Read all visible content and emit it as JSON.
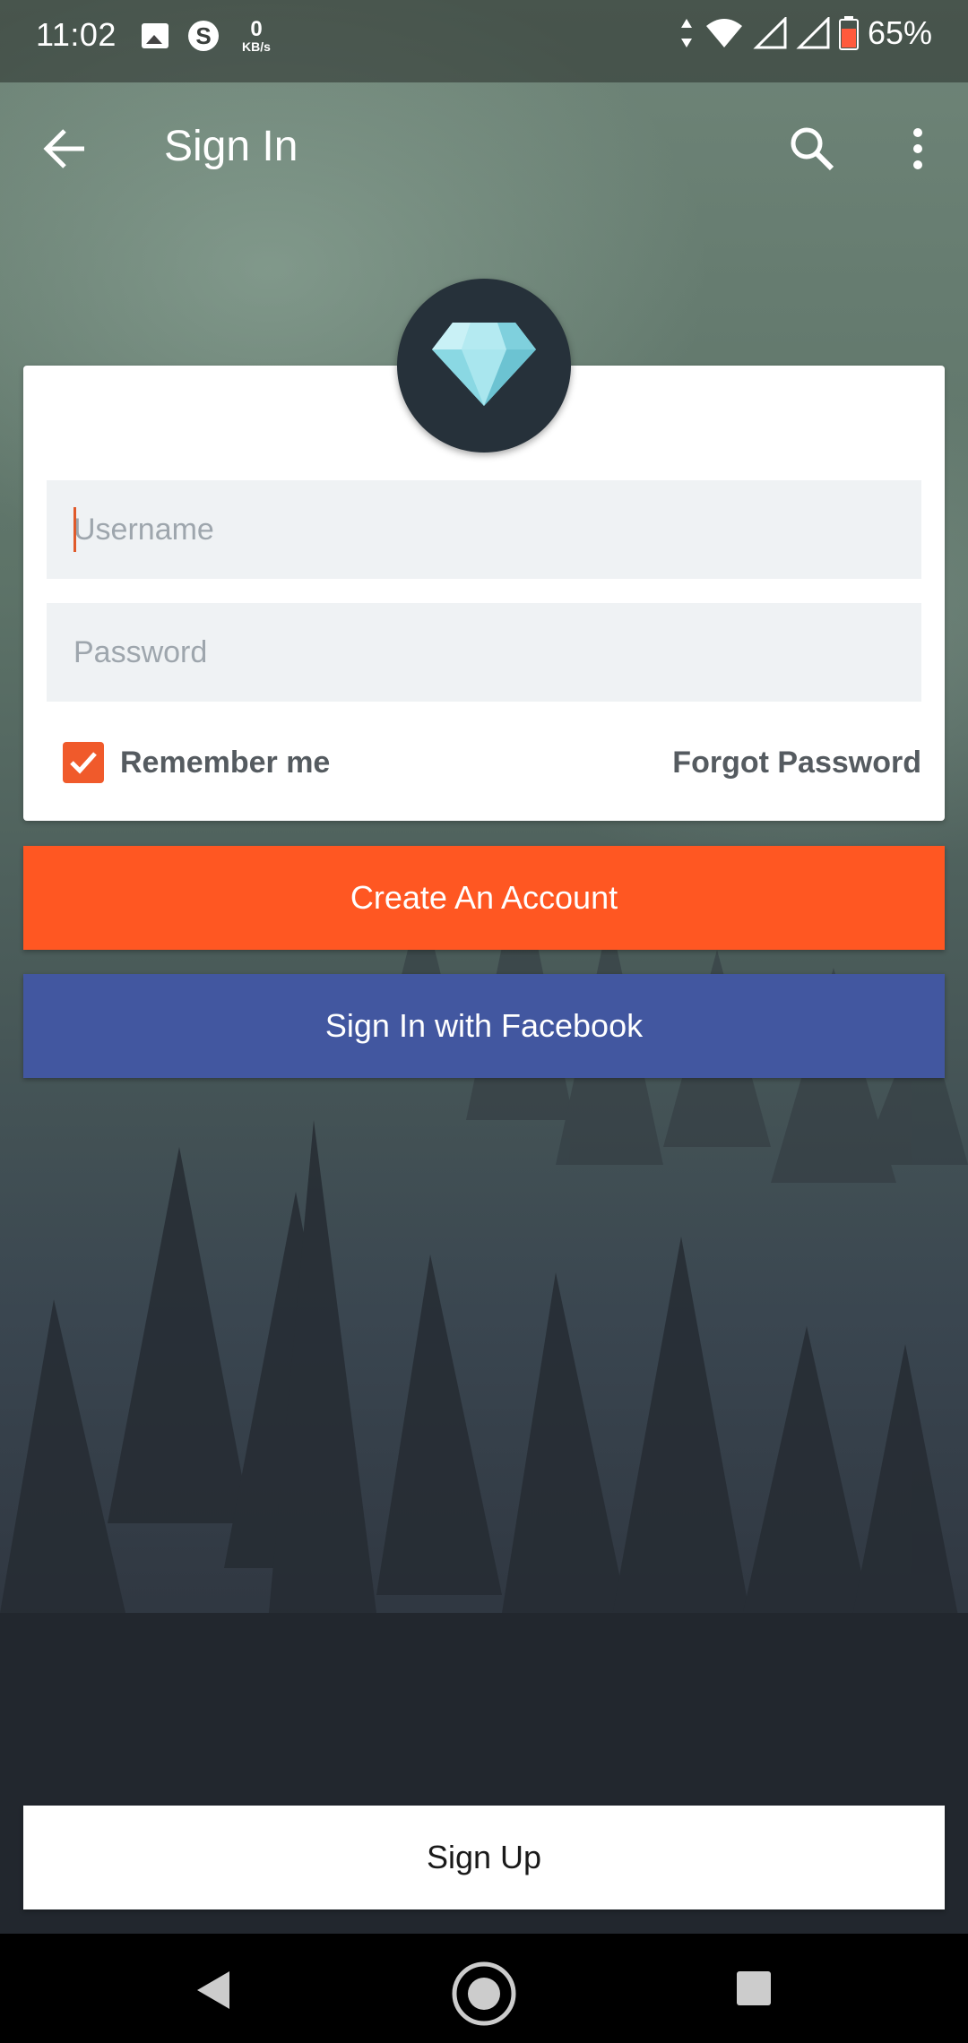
{
  "status_bar": {
    "time": "11:02",
    "data_rate_value": "0",
    "data_rate_unit": "KB/s",
    "battery_percent": "65%",
    "icons": [
      "image-icon",
      "skype-icon",
      "data-arrows-icon",
      "wifi-icon",
      "signal-icon",
      "signal-icon",
      "battery-icon"
    ]
  },
  "app_bar": {
    "title": "Sign In",
    "icons": [
      "back-arrow-icon",
      "search-icon",
      "more-vert-icon"
    ]
  },
  "form": {
    "username_placeholder": "Username",
    "username_value": "",
    "password_placeholder": "Password",
    "password_value": "",
    "remember_label": "Remember me",
    "remember_checked": true,
    "forgot_label": "Forgot Password"
  },
  "buttons": {
    "create_account": "Create An Account",
    "facebook": "Sign In with Facebook",
    "sign_up": "Sign Up"
  },
  "colors": {
    "accent": "#ff5722",
    "facebook": "#4257a0",
    "logo_bg": "#26313a",
    "diamond": "#9fe0ea"
  },
  "nav_bar": {
    "icons": [
      "nav-back-icon",
      "nav-home-icon",
      "nav-recents-icon"
    ]
  }
}
